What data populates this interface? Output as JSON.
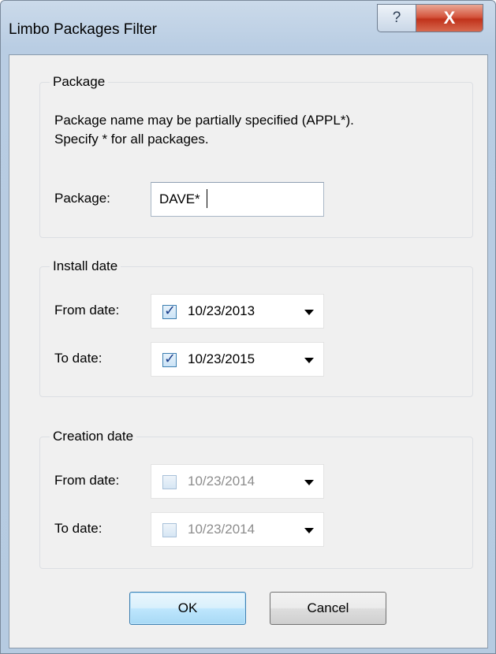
{
  "window": {
    "title": "Limbo Packages Filter",
    "help_glyph": "?",
    "close_glyph": "X"
  },
  "package_group": {
    "legend": "Package",
    "hint_line1": "Package name may be partially specified (APPL*).",
    "hint_line2": "Specify * for all packages.",
    "package_label": "Package:",
    "package_value": "DAVE*"
  },
  "install_group": {
    "legend": "Install date",
    "from_label": "From date:",
    "from_checked": true,
    "from_value": "10/23/2013",
    "to_label": "To date:",
    "to_checked": true,
    "to_value": "10/23/2015"
  },
  "creation_group": {
    "legend": "Creation date",
    "from_label": "From date:",
    "from_checked": false,
    "from_value": "10/23/2014",
    "to_label": "To date:",
    "to_checked": false,
    "to_value": "10/23/2014"
  },
  "buttons": {
    "ok_label": "OK",
    "cancel_label": "Cancel"
  },
  "colors": {
    "frame": "#b9cde3",
    "close": "#c1331c",
    "client": "#f0f0f0",
    "checkmark": "#1a3e8a",
    "disabled_text": "#8d8d8d"
  }
}
